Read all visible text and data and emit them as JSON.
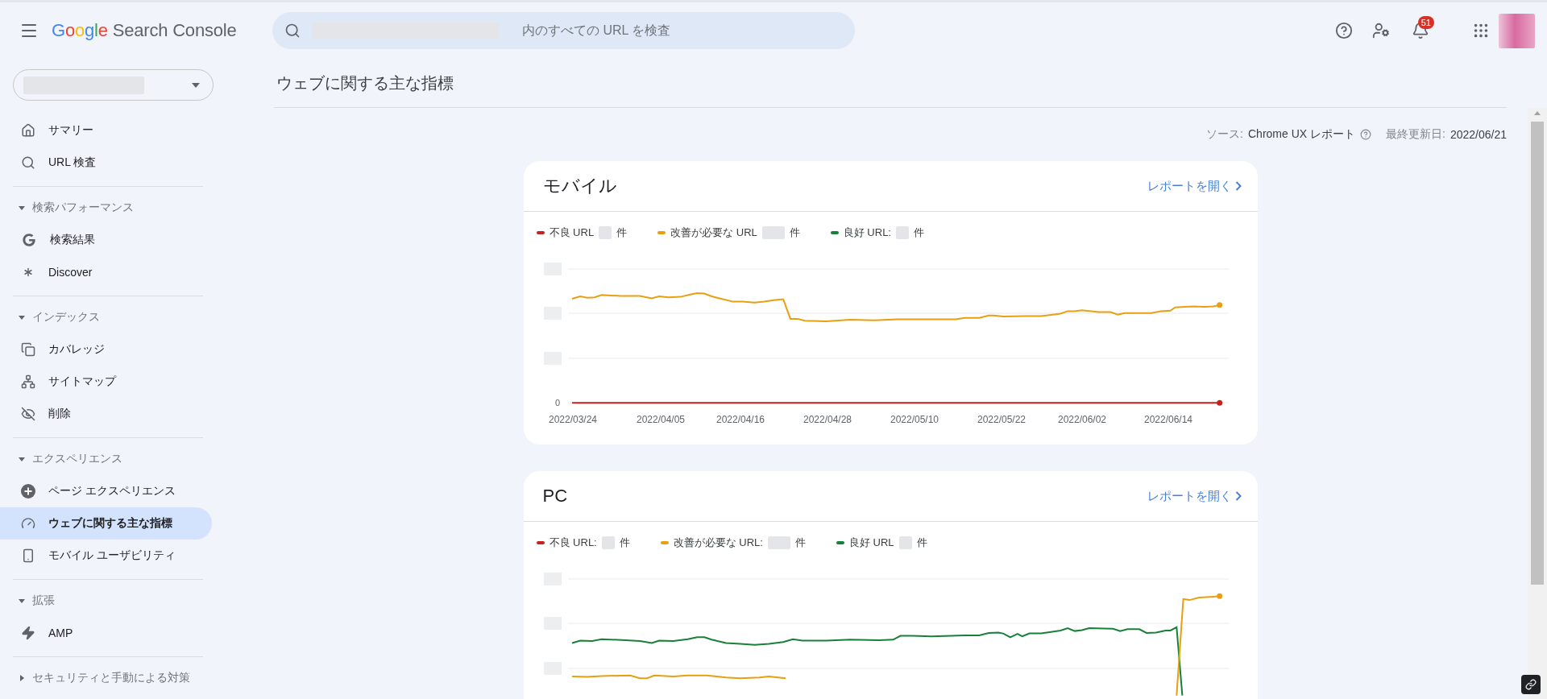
{
  "header": {
    "logo": {
      "brand": "Google",
      "product": "Search Console"
    },
    "search": {
      "placeholder": "内のすべての URL を検査"
    },
    "notifications": {
      "badge": "51"
    }
  },
  "sidebar": {
    "groups": [
      {
        "items": [
          {
            "label": "サマリー",
            "selected": false
          },
          {
            "label": "URL 検査",
            "selected": false
          }
        ]
      },
      {
        "title": "検索パフォーマンス",
        "expanded": true,
        "items": [
          {
            "label": "検索結果",
            "selected": false
          },
          {
            "label": "Discover",
            "selected": false
          }
        ]
      },
      {
        "title": "インデックス",
        "expanded": true,
        "items": [
          {
            "label": "カバレッジ",
            "selected": false
          },
          {
            "label": "サイトマップ",
            "selected": false
          },
          {
            "label": "削除",
            "selected": false
          }
        ]
      },
      {
        "title": "エクスペリエンス",
        "expanded": true,
        "items": [
          {
            "label": "ページ エクスペリエンス",
            "selected": false
          },
          {
            "label": "ウェブに関する主な指標",
            "selected": true
          },
          {
            "label": "モバイル ユーザビリティ",
            "selected": false
          }
        ]
      },
      {
        "title": "拡張",
        "expanded": true,
        "items": [
          {
            "label": "AMP",
            "selected": false
          }
        ]
      },
      {
        "title": "セキュリティと手動による対策",
        "expanded": false
      }
    ]
  },
  "page": {
    "title": "ウェブに関する主な指標",
    "source_label": "ソース:",
    "source": "Chrome UX レポート",
    "updated_label": "最終更新日:",
    "updated": "2022/06/21"
  },
  "cards": [
    {
      "title": "モバイル",
      "link": "レポートを開く",
      "legend": [
        {
          "label": "不良 URL",
          "unit": "件",
          "color": "#c5221f"
        },
        {
          "label": "改善が必要な URL",
          "unit": "件",
          "color": "#e8a010"
        },
        {
          "label": "良好 URL:",
          "unit": "件",
          "color": "#188038"
        }
      ],
      "zero_tick": "0",
      "dates": [
        "2022/03/24",
        "2022/04/05",
        "2022/04/16",
        "2022/04/28",
        "2022/05/10",
        "2022/05/22",
        "2022/06/02",
        "2022/06/14"
      ]
    },
    {
      "title": "PC",
      "link": "レポートを開く",
      "legend": [
        {
          "label": "不良 URL:",
          "unit": "件",
          "color": "#c5221f"
        },
        {
          "label": "改善が必要な URL:",
          "unit": "件",
          "color": "#e8a010"
        },
        {
          "label": "良好 URL",
          "unit": "件",
          "color": "#188038"
        }
      ]
    }
  ]
}
